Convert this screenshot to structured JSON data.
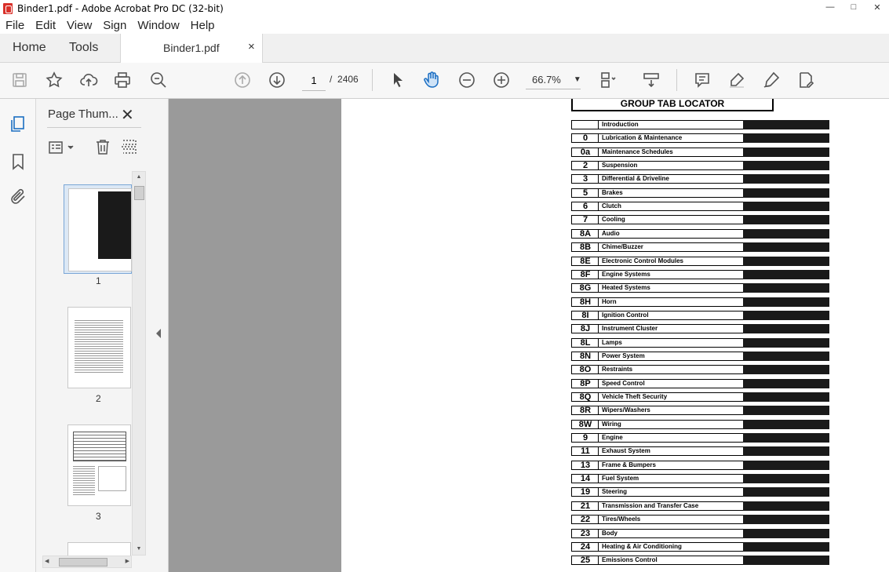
{
  "window": {
    "title": "Binder1.pdf - Adobe Acrobat Pro DC (32-bit)"
  },
  "menu": [
    "File",
    "Edit",
    "View",
    "Sign",
    "Window",
    "Help"
  ],
  "tabs": {
    "home": "Home",
    "tools": "Tools",
    "document": "Binder1.pdf",
    "close": "×"
  },
  "toolbar": {
    "page_current": "1",
    "page_separator": "/",
    "page_total": "2406",
    "zoom": "66.7%"
  },
  "thumbnails": {
    "panel_title": "Page Thum...",
    "labels": [
      "1",
      "2",
      "3"
    ]
  },
  "locator": {
    "title": "GROUP TAB LOCATOR",
    "rows": [
      {
        "num": "",
        "label": "Introduction"
      },
      {
        "num": "0",
        "label": "Lubrication & Maintenance"
      },
      {
        "num": "0a",
        "label": "Maintenance Schedules"
      },
      {
        "num": "2",
        "label": "Suspension"
      },
      {
        "num": "3",
        "label": "Differential & Driveline"
      },
      {
        "num": "5",
        "label": "Brakes"
      },
      {
        "num": "6",
        "label": "Clutch"
      },
      {
        "num": "7",
        "label": "Cooling"
      },
      {
        "num": "8A",
        "label": "Audio"
      },
      {
        "num": "8B",
        "label": "Chime/Buzzer"
      },
      {
        "num": "8E",
        "label": "Electronic Control Modules"
      },
      {
        "num": "8F",
        "label": "Engine Systems"
      },
      {
        "num": "8G",
        "label": "Heated Systems"
      },
      {
        "num": "8H",
        "label": "Horn"
      },
      {
        "num": "8I",
        "label": "Ignition Control"
      },
      {
        "num": "8J",
        "label": "Instrument Cluster"
      },
      {
        "num": "8L",
        "label": "Lamps"
      },
      {
        "num": "8N",
        "label": "Power System"
      },
      {
        "num": "8O",
        "label": "Restraints"
      },
      {
        "num": "8P",
        "label": "Speed Control"
      },
      {
        "num": "8Q",
        "label": "Vehicle Theft Security"
      },
      {
        "num": "8R",
        "label": "Wipers/Washers"
      },
      {
        "num": "8W",
        "label": "Wiring"
      },
      {
        "num": "9",
        "label": "Engine"
      },
      {
        "num": "11",
        "label": "Exhaust System"
      },
      {
        "num": "13",
        "label": "Frame & Bumpers"
      },
      {
        "num": "14",
        "label": "Fuel System"
      },
      {
        "num": "19",
        "label": "Steering"
      },
      {
        "num": "21",
        "label": "Transmission and Transfer Case"
      },
      {
        "num": "22",
        "label": "Tires/Wheels"
      },
      {
        "num": "23",
        "label": "Body"
      },
      {
        "num": "24",
        "label": "Heating & Air Conditioning"
      },
      {
        "num": "25",
        "label": "Emissions Control"
      }
    ]
  }
}
